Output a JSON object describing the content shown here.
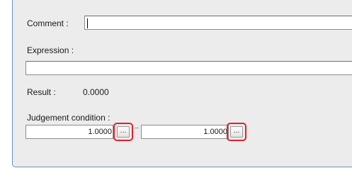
{
  "comment": {
    "label": "Comment :",
    "value": ""
  },
  "expression": {
    "label": "Expression :",
    "value": ""
  },
  "result": {
    "label": "Result :",
    "value": "0.0000"
  },
  "judgement": {
    "label": "Judgement condition :",
    "lower_value": "1.0000",
    "upper_value": "1.0000",
    "button_label": "..."
  },
  "colors": {
    "panel_border": "#6a8fc4",
    "highlight": "#e3222b"
  }
}
